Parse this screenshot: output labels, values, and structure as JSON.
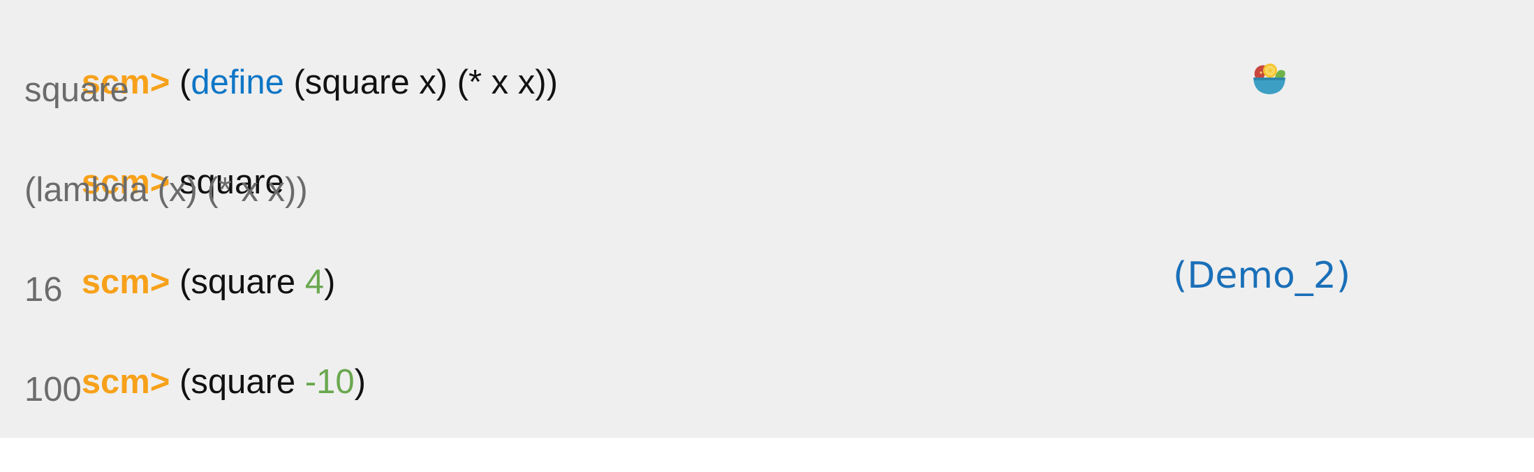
{
  "colors": {
    "prompt": "#f7a11a",
    "keyword": "#0e76c6",
    "number": "#6aa84f",
    "plain": "#111111",
    "output": "#6b6b6b",
    "demo_link": "#1a6fb8",
    "panel_bg": "#efefef"
  },
  "repl": {
    "prompt_text": "scm>",
    "entries": [
      {
        "input": {
          "open": "(",
          "keyword": "define",
          "rest": " (square x) (* x x))"
        },
        "output": "square"
      },
      {
        "input": {
          "text": "square"
        },
        "output": "(lambda (x) (* x x))"
      },
      {
        "input": {
          "before": "(square ",
          "number": "4",
          "after": ")"
        },
        "output": "16"
      },
      {
        "input": {
          "before": "(square ",
          "number": "-10",
          "after": ")"
        },
        "output": "100"
      }
    ]
  },
  "demo": {
    "label": "(Demo_2)"
  },
  "icons": {
    "bowl": "salad-bowl-icon"
  }
}
